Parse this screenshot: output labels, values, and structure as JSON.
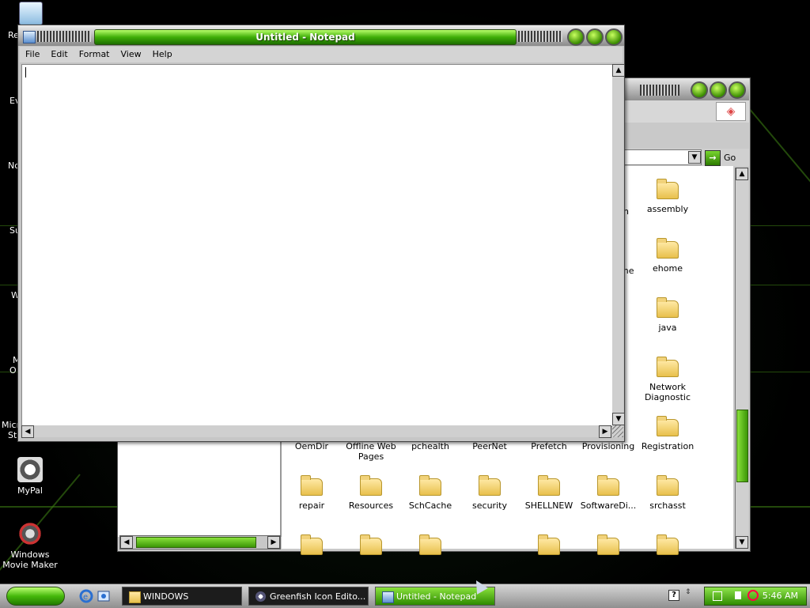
{
  "desktop": {
    "icons": [
      {
        "label": "MyPal",
        "icon": "mypal-icon"
      },
      {
        "label": "Windows Movie Maker",
        "icon": "movie-maker-icon"
      }
    ],
    "clipped_labels": [
      "Re",
      "Ev",
      "No",
      "Su",
      "W",
      "M",
      "O",
      "Micro",
      "Stu"
    ]
  },
  "explorer": {
    "address": {
      "go_label": "Go"
    },
    "partial_labels": [
      "n",
      "me"
    ],
    "folders": [
      {
        "label": "assembly"
      },
      {
        "label": "ehome"
      },
      {
        "label": "java"
      },
      {
        "label": "Network Diagnostic"
      },
      {
        "label": "OemDir"
      },
      {
        "label": "Offline Web Pages"
      },
      {
        "label": "pchealth"
      },
      {
        "label": "PeerNet"
      },
      {
        "label": "Prefetch"
      },
      {
        "label": "Provisioning"
      },
      {
        "label": "Registration"
      },
      {
        "label": "repair"
      },
      {
        "label": "Resources"
      },
      {
        "label": "SchCache"
      },
      {
        "label": "security"
      },
      {
        "label": "SHELLNEW"
      },
      {
        "label": "SoftwareDi..."
      },
      {
        "label": "srchasst"
      }
    ]
  },
  "notepad": {
    "title": "Untitled - Notepad",
    "menu": [
      "File",
      "Edit",
      "Format",
      "View",
      "Help"
    ],
    "text": ""
  },
  "taskbar": {
    "tasks": [
      {
        "label": "WINDOWS",
        "icon": "folder-icon",
        "active": false
      },
      {
        "label": "Greenfish Icon Edito...",
        "icon": "greenfish-icon",
        "active": false
      },
      {
        "label": "Untitled - Notepad",
        "icon": "notepad-icon",
        "active": true
      }
    ],
    "clock": "5:46 AM"
  },
  "colors": {
    "accent": "#4cb80f",
    "accent_dark": "#1d6e00",
    "chrome": "#c6c6c6"
  }
}
